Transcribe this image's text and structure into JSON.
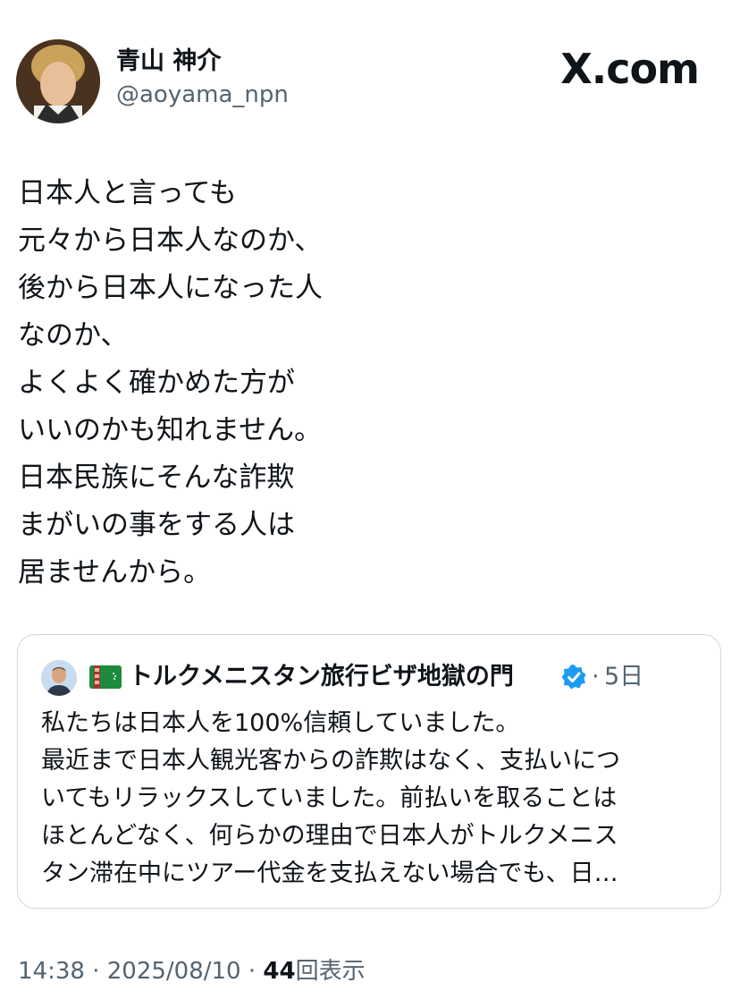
{
  "author": {
    "display_name": "青山 神介",
    "handle": "@aoyama_npn"
  },
  "site_logo": "X.com",
  "tweet_lines": [
    "日本人と言っても",
    "元々から日本人なのか、",
    "後から日本人になった人",
    "なのか、",
    "よくよく確かめた方が",
    "いいのかも知れません。",
    "日本民族にそんな詐欺",
    "まがいの事をする人は",
    "居ませんから。"
  ],
  "quote": {
    "name": "トルクメニスタン旅行ビザ地獄の門",
    "separator": "·",
    "time": "5日",
    "flag_icon": "turkmenistan-flag-icon",
    "verified_color": "#1d9bf0",
    "lines": [
      "私たちは日本人を100%信頼していました。",
      "最近まで日本人観光客からの詐欺はなく、支払いにつ",
      "いてもリラックスしていました。前払いを取ることは",
      "ほとんどなく、何らかの理由で日本人がトルクメニス",
      "タン滞在中にツアー代金を支払えない場合でも、日…"
    ]
  },
  "meta": {
    "time": "14:38",
    "date": "2025/08/10",
    "views_count": "44",
    "views_label": "回表示",
    "separator": "·"
  }
}
